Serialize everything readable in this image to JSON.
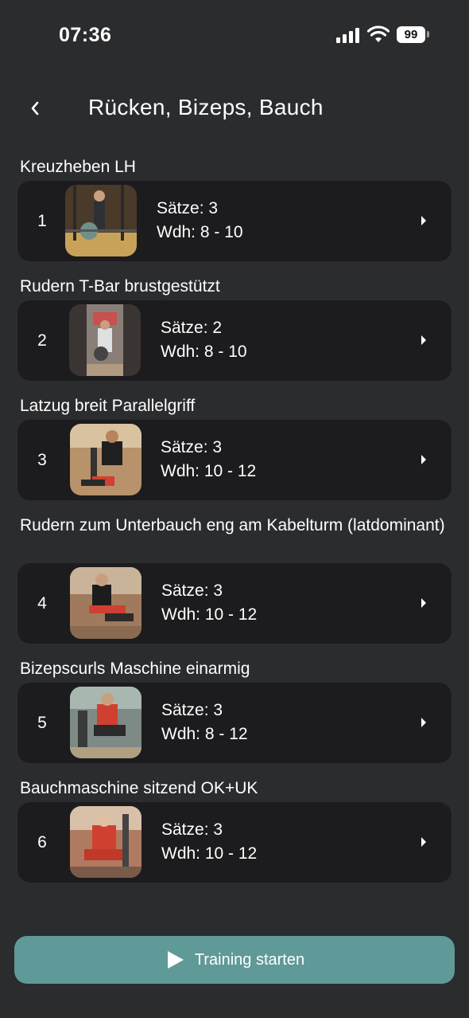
{
  "status_bar": {
    "time": "07:36",
    "battery": "99"
  },
  "header": {
    "title": "Rücken, Bizeps, Bauch"
  },
  "exercises": [
    {
      "index": "1",
      "name": "Kreuzheben LH",
      "sets": "Sätze: 3",
      "reps": "Wdh: 8 - 10",
      "thumb_color": "#c9a25a"
    },
    {
      "index": "2",
      "name": "Rudern T-Bar brustgestützt",
      "sets": "Sätze: 2",
      "reps": "Wdh: 8 - 10",
      "thumb_color": "#8a7f78"
    },
    {
      "index": "3",
      "name": "Latzug breit Parallelgriff",
      "sets": "Sätze: 3",
      "reps": "Wdh: 10 - 12",
      "thumb_color": "#b8926a"
    },
    {
      "index": "4",
      "name": "Rudern zum Unterbauch eng am Kabelturm (latdominant)",
      "sets": "Sätze: 3",
      "reps": "Wdh: 10 - 12",
      "thumb_color": "#a07a5c"
    },
    {
      "index": "5",
      "name": "Bizepscurls Maschine einarmig",
      "sets": "Sätze: 3",
      "reps": "Wdh: 8 - 12",
      "thumb_color": "#7e8a86"
    },
    {
      "index": "6",
      "name": "Bauchmaschine sitzend OK+UK",
      "sets": "Sätze: 3",
      "reps": "Wdh: 10 - 12",
      "thumb_color": "#b07a60"
    }
  ],
  "start_button": {
    "label": "Training starten",
    "color": "#5f9a98"
  }
}
